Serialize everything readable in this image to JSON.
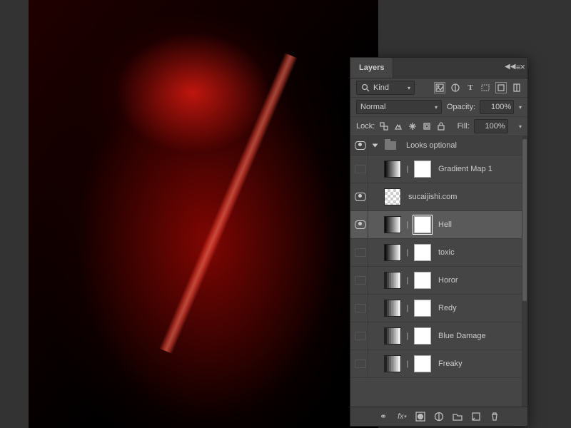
{
  "canvas": {
    "description": "Red glitch portrait artwork"
  },
  "panel": {
    "title": "Layers",
    "collapse_icon": "collapse",
    "close_icon": "close",
    "menu_icon": "menu",
    "filter": {
      "search_icon": "search",
      "kind_label": "Kind",
      "icons": [
        "image",
        "adjustment",
        "type",
        "shape",
        "smartobject",
        "artboard"
      ]
    },
    "blend": {
      "mode": "Normal",
      "opacity_label": "Opacity:",
      "opacity_value": "100%"
    },
    "lock": {
      "label": "Lock:",
      "fill_label": "Fill:",
      "fill_value": "100%",
      "icons": [
        "transparent",
        "image",
        "position",
        "artboard",
        "all"
      ]
    },
    "group": {
      "name": "Looks optional"
    },
    "layers": [
      {
        "name": "Gradient Map 1",
        "thumb": "gradient",
        "mask": true,
        "visible": false,
        "selected": false
      },
      {
        "name": "sucaijishi.com",
        "thumb": "transparent",
        "mask": false,
        "visible": true,
        "selected": false
      },
      {
        "name": "Hell",
        "thumb": "gradient",
        "mask": true,
        "visible": true,
        "selected": true
      },
      {
        "name": "toxic",
        "thumb": "gradient",
        "mask": true,
        "visible": false,
        "selected": false
      },
      {
        "name": "Horor",
        "thumb": "posterize",
        "mask": true,
        "visible": false,
        "selected": false
      },
      {
        "name": "Redy",
        "thumb": "posterize",
        "mask": true,
        "visible": false,
        "selected": false
      },
      {
        "name": "Blue Damage",
        "thumb": "posterize",
        "mask": true,
        "visible": false,
        "selected": false
      },
      {
        "name": "Freaky",
        "thumb": "posterize",
        "mask": true,
        "visible": false,
        "selected": false
      }
    ],
    "footer_icons": [
      "link",
      "fx",
      "mask",
      "adjustment",
      "group",
      "new",
      "delete"
    ]
  }
}
